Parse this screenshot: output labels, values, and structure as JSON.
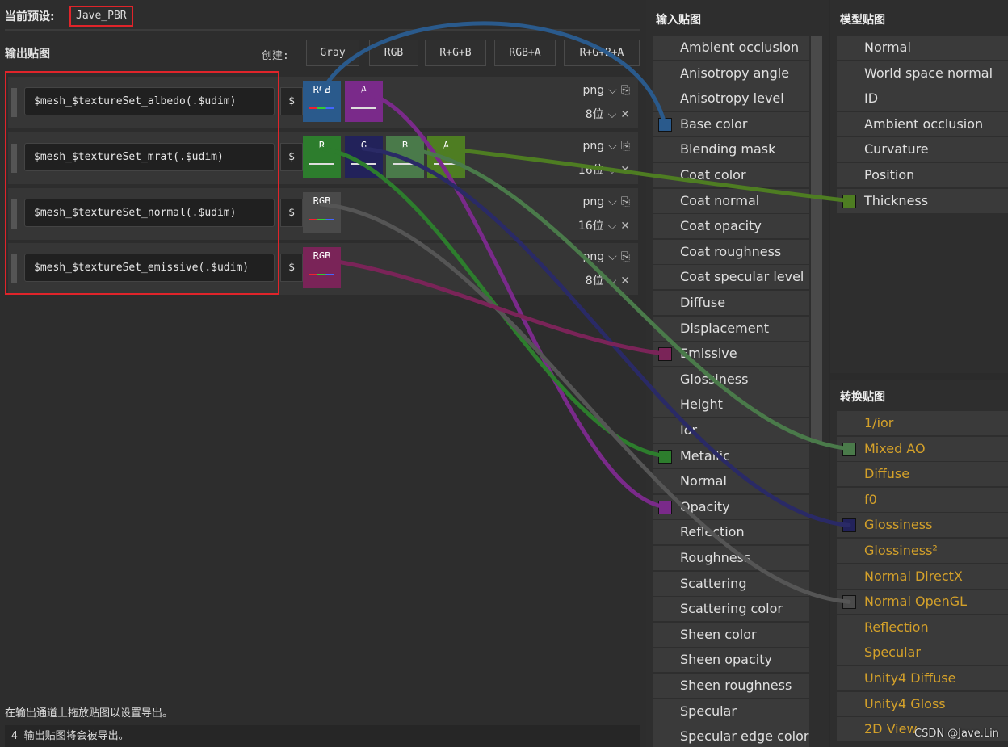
{
  "preset": {
    "label": "当前预设:",
    "name": "Jave_PBR"
  },
  "outputs": {
    "title": "输出贴图",
    "create_label": "创建:",
    "create_buttons": [
      "Gray",
      "RGB",
      "R+G+B",
      "RGB+A",
      "R+G+B+A"
    ],
    "rows": [
      {
        "name": "$mesh_$textureSet_albedo(.$udim)",
        "dollar": "$",
        "format": "png",
        "bits": "8位",
        "channels": [
          {
            "label": "RGB",
            "color": "#2a5a8c"
          },
          {
            "label": "A",
            "color": "#7a2a8a"
          }
        ]
      },
      {
        "name": "$mesh_$textureSet_mrat(.$udim)",
        "dollar": "$",
        "format": "png",
        "bits": "16位",
        "channels": [
          {
            "label": "R",
            "color": "#2d7d2d"
          },
          {
            "label": "G",
            "color": "#22225a"
          },
          {
            "label": "B",
            "color": "#4a7a4a"
          },
          {
            "label": "A",
            "color": "#4e7d22"
          }
        ]
      },
      {
        "name": "$mesh_$textureSet_normal(.$udim)",
        "dollar": "$",
        "format": "png",
        "bits": "16位",
        "channels": [
          {
            "label": "RGB",
            "color": "#4a4a4a"
          }
        ]
      },
      {
        "name": "$mesh_$textureSet_emissive(.$udim)",
        "dollar": "$",
        "format": "png",
        "bits": "8位",
        "channels": [
          {
            "label": "RGB",
            "color": "#7a2458"
          }
        ]
      }
    ],
    "hint": "在输出通道上拖放贴图以设置导出。",
    "status": "4 输出贴图将会被导出。"
  },
  "input_maps": {
    "title": "输入贴图",
    "items": [
      {
        "label": "Ambient occlusion"
      },
      {
        "label": "Anisotropy angle"
      },
      {
        "label": "Anisotropy level"
      },
      {
        "label": "Base color",
        "swatch": "#2a5a8c"
      },
      {
        "label": "Blending mask"
      },
      {
        "label": "Coat color"
      },
      {
        "label": "Coat normal"
      },
      {
        "label": "Coat opacity"
      },
      {
        "label": "Coat roughness"
      },
      {
        "label": "Coat specular level"
      },
      {
        "label": "Diffuse"
      },
      {
        "label": "Displacement"
      },
      {
        "label": "Emissive",
        "swatch": "#7a2458"
      },
      {
        "label": "Glossiness"
      },
      {
        "label": "Height"
      },
      {
        "label": "Ior"
      },
      {
        "label": "Metallic",
        "swatch": "#2d7d2d"
      },
      {
        "label": "Normal"
      },
      {
        "label": "Opacity",
        "swatch": "#7a2a8a"
      },
      {
        "label": "Reflection"
      },
      {
        "label": "Roughness"
      },
      {
        "label": "Scattering"
      },
      {
        "label": "Scattering color"
      },
      {
        "label": "Sheen color"
      },
      {
        "label": "Sheen opacity"
      },
      {
        "label": "Sheen roughness"
      },
      {
        "label": "Specular"
      },
      {
        "label": "Specular edge color"
      }
    ]
  },
  "model_maps": {
    "title": "模型贴图",
    "items": [
      {
        "label": "Normal"
      },
      {
        "label": "World space normal"
      },
      {
        "label": "ID"
      },
      {
        "label": "Ambient occlusion"
      },
      {
        "label": "Curvature"
      },
      {
        "label": "Position"
      },
      {
        "label": "Thickness",
        "swatch": "#4e7d22"
      }
    ]
  },
  "converted_maps": {
    "title": "转换贴图",
    "items": [
      {
        "label": "1/ior"
      },
      {
        "label": "Mixed AO",
        "swatch": "#4a7a4a"
      },
      {
        "label": "Diffuse"
      },
      {
        "label": "f0"
      },
      {
        "label": "Glossiness",
        "swatch": "#22225a"
      },
      {
        "label": "Glossiness²"
      },
      {
        "label": "Normal DirectX"
      },
      {
        "label": "Normal OpenGL",
        "swatch": "#4a4a4a"
      },
      {
        "label": "Reflection"
      },
      {
        "label": "Specular"
      },
      {
        "label": "Unity4 Diffuse"
      },
      {
        "label": "Unity4 Gloss"
      },
      {
        "label": "2D View"
      }
    ]
  },
  "watermark": "CSDN @Jave.Lin",
  "icons": {
    "dropdown": "chevron-down-icon",
    "copy": "copy-icon",
    "remove": "close-icon"
  },
  "accent_colors": {
    "highlight_border": "#e0242a",
    "converted_text": "#d4a12a"
  }
}
